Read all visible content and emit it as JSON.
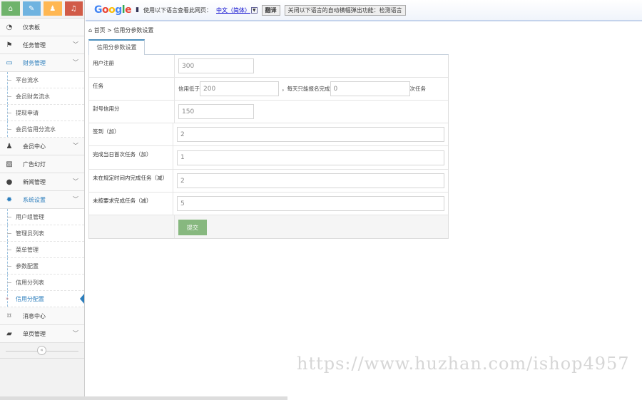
{
  "shortcuts": [
    {
      "icon": "home-icon",
      "color": "#6fb36b"
    },
    {
      "icon": "pencil-icon",
      "color": "#6fb3e0"
    },
    {
      "icon": "users-icon",
      "color": "#ffb752"
    },
    {
      "icon": "bell-icon",
      "color": "#d15b47"
    }
  ],
  "sidebar": {
    "items": [
      {
        "label": "仪表板",
        "icon": "dashboard-icon",
        "glyph": "◔",
        "chev": false
      },
      {
        "label": "任务管理",
        "icon": "flag-icon",
        "glyph": "⚑",
        "chev": true
      },
      {
        "label": "财务管理",
        "icon": "credit-card-icon",
        "glyph": "▭",
        "chev": true,
        "open": true,
        "subs": [
          "平台流水",
          "会员财务流水",
          "提现申请",
          "会员信用分流水"
        ]
      },
      {
        "label": "会员中心",
        "icon": "user-icon",
        "glyph": "♟",
        "chev": true
      },
      {
        "label": "广告幻灯",
        "icon": "picture-icon",
        "glyph": "▨",
        "chev": false
      },
      {
        "label": "新闻管理",
        "icon": "globe-icon",
        "glyph": "●",
        "chev": true
      },
      {
        "label": "系统设置",
        "icon": "cog-icon",
        "glyph": "✹",
        "chev": true,
        "open": true,
        "subs": [
          "用户组管理",
          "管理员列表",
          "菜单管理",
          "参数配置",
          "信用分列表",
          "信用分配置"
        ],
        "active": "信用分配置"
      },
      {
        "label": "消息中心",
        "icon": "bookmark-icon",
        "glyph": "⌑",
        "chev": false
      },
      {
        "label": "单页管理",
        "icon": "book-icon",
        "glyph": "▰",
        "chev": true
      }
    ],
    "collapse": "«"
  },
  "translate": {
    "logo": "Google",
    "prompt": "使用以下语言查看此网页：",
    "language": "中文（简体）",
    "translate_btn": "翻译",
    "disable_btn": "关闭以下语言的自动横幅弹出功能：检测语言"
  },
  "breadcrumb": {
    "home": "首页",
    "sep": ">",
    "current": "信用分参数设置"
  },
  "tab": "信用分参数设置",
  "form": {
    "register": {
      "label": "用户注册",
      "value": "300"
    },
    "task": {
      "label": "任务",
      "pre": "信用低于",
      "value1": "200",
      "mid": "，每天只能报名完成",
      "value2": "0",
      "post": "次任务"
    },
    "ban": {
      "label": "封号信用分",
      "value": "150"
    },
    "signin": {
      "label": "签到（加）",
      "value": "2"
    },
    "first_task": {
      "label": "完成当日首次任务（加）",
      "value": "1"
    },
    "overdue": {
      "label": "未在规定时间内完成任务（减）",
      "value": "2"
    },
    "noncompliant": {
      "label": "未按要求完成任务（减）",
      "value": "5"
    },
    "submit": "提交"
  },
  "watermark": "https://www.huzhan.com/ishop4957"
}
